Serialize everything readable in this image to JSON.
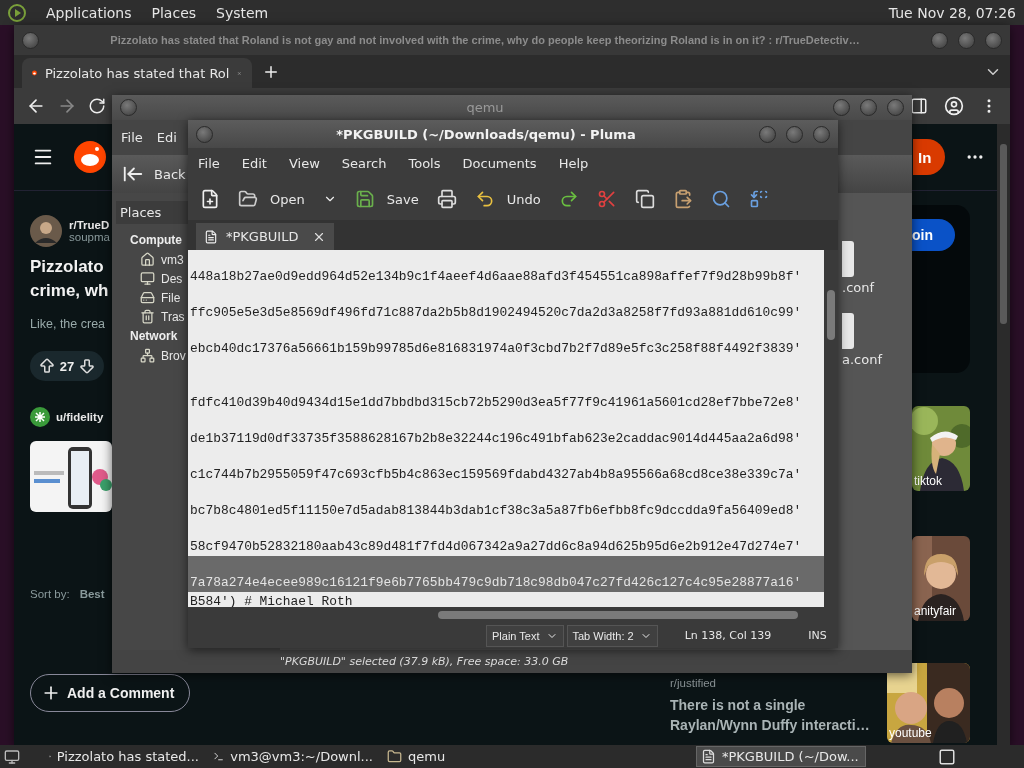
{
  "top_panel": {
    "menus": [
      "Applications",
      "Places",
      "System"
    ],
    "clock": "Tue Nov 28, 07:26"
  },
  "browser": {
    "title": "Pizzolato has stated that Roland is not gay and not involved with the crime, why do people keep theorizing Roland is in on it? : r/TrueDetectiv…",
    "tabs": [
      {
        "label": "Pizzolato has stated that Rol",
        "selected": true
      }
    ],
    "page": {
      "login": "In",
      "left": {
        "subreddit": "r/TrueD",
        "user": "soupma",
        "title_lines": [
          "Pizzolato",
          "crime, wh"
        ],
        "body": "Like, the crea",
        "votes": "27",
        "ad_user": "u/fidelity",
        "sort_label": "Sort by:",
        "sort_value": "Best",
        "add_comment": "Add a Comment"
      },
      "right": {
        "join": "oin",
        "thumbnails": [
          {
            "caption": "tiktok"
          },
          {
            "caption": "anityfair"
          }
        ],
        "related": {
          "subreddit": "r/justified",
          "title_lines": [
            "There is not a single",
            "Raylan/Wynn Duffy interacti…"
          ],
          "thumb_caption": "youtube"
        }
      }
    }
  },
  "file_manager": {
    "title": "qemu",
    "menus": [
      "File",
      "Edi"
    ],
    "back": "Back",
    "places_header": "Places",
    "sections": [
      {
        "label": "Compute",
        "items": [
          {
            "label": "vm3",
            "kind": "home"
          },
          {
            "label": "Des",
            "kind": "desktop"
          },
          {
            "label": "File",
            "kind": "filesystem"
          },
          {
            "label": "Tras",
            "kind": "trash"
          }
        ]
      },
      {
        "label": "Network",
        "items": [
          {
            "label": "Brov",
            "kind": "network"
          }
        ]
      }
    ],
    "files": [
      {
        "label": ".conf"
      },
      {
        "label": "a.conf"
      }
    ],
    "status": "\"PKGBUILD\" selected (37.9 kB), Free space: 33.0 GB"
  },
  "editor": {
    "title": "*PKGBUILD (~/Downloads/qemu) - Pluma",
    "menus": [
      "File",
      "Edit",
      "View",
      "Search",
      "Tools",
      "Documents",
      "Help"
    ],
    "toolbar": [
      {
        "kind": "new"
      },
      {
        "kind": "open",
        "label": "Open"
      },
      {
        "kind": "menu"
      },
      {
        "kind": "save",
        "label": "Save"
      },
      {
        "kind": "print"
      },
      {
        "kind": "undo",
        "label": "Undo"
      },
      {
        "kind": "redo"
      },
      {
        "kind": "cut"
      },
      {
        "kind": "copy"
      },
      {
        "kind": "paste"
      },
      {
        "kind": "find"
      },
      {
        "kind": "replace"
      }
    ],
    "tabs": [
      {
        "label": "*PKGBUILD",
        "selected": true
      }
    ],
    "lines": [
      {
        "text": "448a18b27ae0d9edd964d52e134b9c1f4aeef4d6aae88afd3f454551ca898affef7f9d28b99b8f'",
        "kind": "line"
      },
      {
        "text": "ffc905e5e3d5e8569df496fd71c887da2b5b8d1902494520c7da2d3a8258f7fd93a881dd610c99'",
        "kind": "line"
      },
      {
        "text": "ebcb40dc17376a56661b159b99785d6e816831974a0f3cbd7b2f7d89e5fc3c258f88f4492f3839'",
        "kind": "line"
      },
      {
        "text": "fdfc410d39b40d9434d15e1dd7bbdbd315cb72b5290d3ea5f77f9c41961a5601cd28ef7bbe72e8'",
        "kind": "line",
        "spaced": true
      },
      {
        "text": "de1b37119d0df33735f3588628167b2b8e32244c196c491bfab623e2caddac9014d445aa2a6d98'",
        "kind": "line"
      },
      {
        "text": "c1c744b7b2955059f47c693cfb5b4c863ec159569fdabd4327ab4b8a95566a68cd8ce38e339c7a'",
        "kind": "line"
      },
      {
        "text": "bc7b8c4801ed5f11150e7d5adab813844b3dab1cf38c3a5a87fb6efbb8fc9dccdda9fa56409ed8'",
        "kind": "line"
      },
      {
        "text": "58cf9470b52832180aab43c89d481f7fd4d067342a9a27dd6c8a94d625b95d6e2b912e47d274e7'",
        "kind": "line"
      },
      {
        "text": "7a78a274e4ecee989c16121f9e6b7765bb479c9db718c98db047c27fd426c127c4c95e28877a16'",
        "kind": "current"
      },
      {
        "text": "B584') # Michael Roth",
        "kind": "continuation"
      }
    ],
    "status": {
      "language": "Plain Text",
      "tab_width": "Tab Width: 2",
      "position": "Ln 138, Col 139",
      "mode": "INS"
    }
  },
  "taskbar": {
    "items": [
      {
        "label": "Pizzolato has stated...",
        "kind": "browser",
        "selected": false
      },
      {
        "label": "vm3@vm3:~/Downl...",
        "kind": "terminal",
        "selected": false
      },
      {
        "label": "qemu",
        "kind": "folder",
        "selected": false
      },
      {
        "label": "*PKGBUILD (~/Dow...",
        "kind": "editor",
        "selected": true
      }
    ]
  }
}
